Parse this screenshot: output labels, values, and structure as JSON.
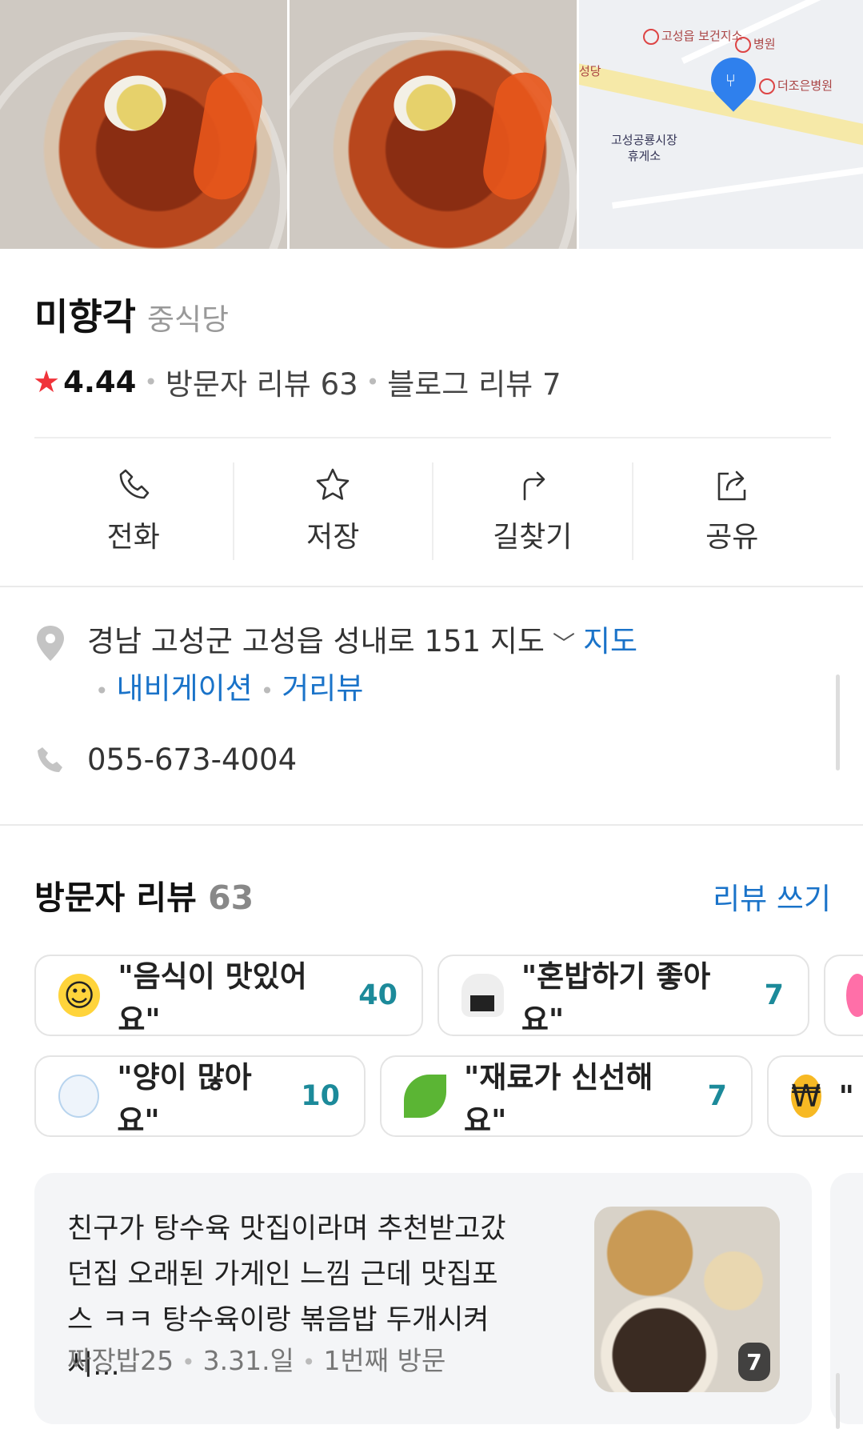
{
  "map": {
    "poi_health_center": "고성읍 보건지소",
    "poi_hospital": "병원",
    "poi_hospital2": "더조은병원",
    "poi_rest_area_line1": "고성공룡시장",
    "poi_rest_area_line2": "휴게소",
    "poi_edge": "성당"
  },
  "place": {
    "name": "미향각",
    "category": "중식당",
    "rating": "4.44",
    "visitor_reviews": "방문자 리뷰 63",
    "blog_reviews": "블로그 리뷰 7"
  },
  "actions": [
    {
      "label": "전화",
      "icon": "phone-icon"
    },
    {
      "label": "저장",
      "icon": "star-icon"
    },
    {
      "label": "길찾기",
      "icon": "directions-icon"
    },
    {
      "label": "공유",
      "icon": "share-icon"
    }
  ],
  "info": {
    "address": "경남 고성군 고성읍 성내로 151",
    "address_map_label": "지도",
    "map_link": "지도",
    "navigation_link": "내비게이션",
    "street_view_link": "거리뷰",
    "phone": "055-673-4004"
  },
  "reviews": {
    "title": "방문자 리뷰",
    "count": "63",
    "write_label": "리뷰 쓰기",
    "keywords_row1": [
      {
        "text": "\"음식이 맛있어요\"",
        "count": "40",
        "emoji": "😋"
      },
      {
        "text": "\"혼밥하기 좋아요\"",
        "count": "7",
        "emoji": "🍙"
      }
    ],
    "keywords_row2": [
      {
        "text": "\"양이 많아요\"",
        "count": "10",
        "emoji": "🍚"
      },
      {
        "text": "\"재료가 신선해요\"",
        "count": "7",
        "emoji": "🌿"
      },
      {
        "text": "\"",
        "count": "",
        "emoji": "💰"
      }
    ],
    "card": {
      "text": "친구가 탕수육 맛집이라며 추천받고갔 던집 오래된 가게인 느낌 근데 맛집포스 ㅋㅋ 탕수육이랑 볶음밥 두개시켜서...",
      "author": "짜장밥25",
      "date": "3.31.일",
      "visit": "1번째 방문",
      "photo_count": "7"
    }
  },
  "colors": {
    "accent_blue": "#1a73c9",
    "star_red": "#f0333a",
    "count_teal": "#1c8a9a"
  }
}
